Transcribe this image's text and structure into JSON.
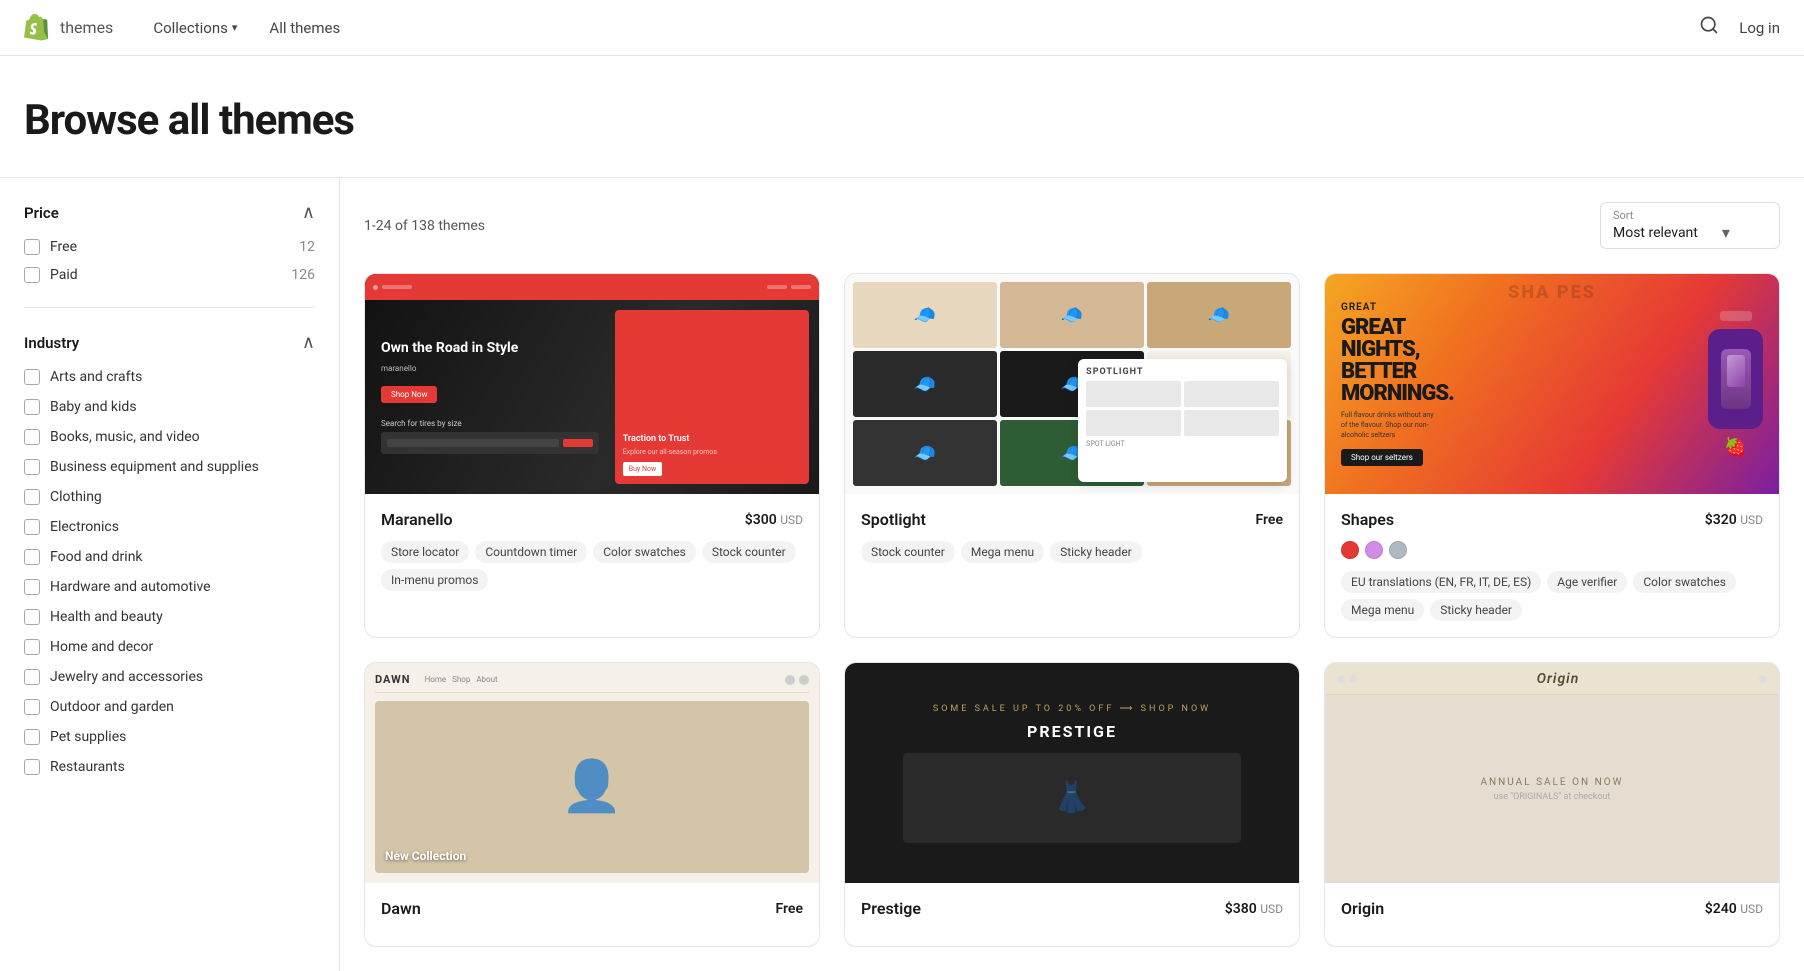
{
  "header": {
    "logo_text": "themes",
    "nav_items": [
      {
        "label": "Collections",
        "has_dropdown": true
      },
      {
        "label": "All themes",
        "has_dropdown": false
      }
    ],
    "login_label": "Log in"
  },
  "page": {
    "title": "Browse all themes"
  },
  "sidebar": {
    "price_section": {
      "title": "Price",
      "items": [
        {
          "label": "Free",
          "count": "12"
        },
        {
          "label": "Paid",
          "count": "126"
        }
      ]
    },
    "industry_section": {
      "title": "Industry",
      "items": [
        "Arts and crafts",
        "Baby and kids",
        "Books, music, and video",
        "Business equipment and supplies",
        "Clothing",
        "Electronics",
        "Food and drink",
        "Hardware and automotive",
        "Health and beauty",
        "Home and decor",
        "Jewelry and accessories",
        "Outdoor and garden",
        "Pet supplies",
        "Restaurants"
      ]
    }
  },
  "content": {
    "results_count": "1-24 of 138 themes",
    "sort": {
      "label": "Sort",
      "value": "Most relevant"
    },
    "themes": [
      {
        "name": "Maranello",
        "price": "$300",
        "currency": "USD",
        "tags": [
          "Store locator",
          "Countdown timer",
          "Color swatches",
          "Stock counter",
          "In-menu promos"
        ],
        "preview_type": "maranello"
      },
      {
        "name": "Spotlight",
        "price": "Free",
        "currency": "",
        "tags": [
          "Stock counter",
          "Mega menu",
          "Sticky header"
        ],
        "preview_type": "spotlight"
      },
      {
        "name": "Shapes",
        "price": "$320",
        "currency": "USD",
        "colors": [
          "#e53935",
          "#d48be8",
          "#b0b8c1"
        ],
        "tags": [
          "EU translations (EN, FR, IT, DE, ES)",
          "Age verifier",
          "Color swatches",
          "Mega menu",
          "Sticky header"
        ],
        "preview_type": "shapes"
      },
      {
        "name": "Dawn",
        "price": "Free",
        "currency": "",
        "tags": [],
        "preview_type": "dawn"
      },
      {
        "name": "Prestige",
        "price": "$380",
        "currency": "USD",
        "tags": [],
        "preview_type": "prestige"
      },
      {
        "name": "Origin",
        "price": "$240",
        "currency": "USD",
        "tags": [],
        "preview_type": "origin"
      }
    ]
  }
}
